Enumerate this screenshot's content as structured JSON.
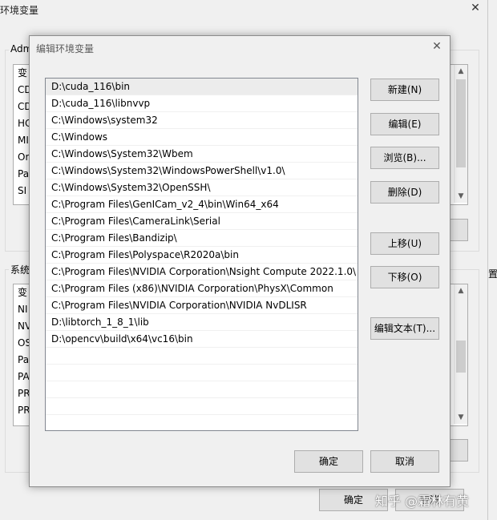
{
  "background_window": {
    "title": "环境变量",
    "close_glyph": "✕",
    "user_group_label": "Adm",
    "user_vars": [
      "变",
      "CD",
      "CD",
      "HC",
      "MI",
      "Or",
      "Pa",
      "SI"
    ],
    "system_group_label": "系统",
    "system_vars": [
      "变",
      "NI",
      "NV",
      "OS",
      "Pa",
      "PA",
      "PR",
      "PR"
    ],
    "side_text": "置",
    "ok_label": "确定",
    "cancel_label": "取消",
    "scroll_up": "▲",
    "scroll_down": "▼"
  },
  "watermark": "知乎 @霜林有黄",
  "dialog": {
    "title": "编辑环境变量",
    "close_glyph": "✕",
    "paths": [
      "D:\\cuda_116\\bin",
      "D:\\cuda_116\\libnvvp",
      "C:\\Windows\\system32",
      "C:\\Windows",
      "C:\\Windows\\System32\\Wbem",
      "C:\\Windows\\System32\\WindowsPowerShell\\v1.0\\",
      "C:\\Windows\\System32\\OpenSSH\\",
      "C:\\Program Files\\GenICam_v2_4\\bin\\Win64_x64",
      "C:\\Program Files\\CameraLink\\Serial",
      "C:\\Program Files\\Bandizip\\",
      "C:\\Program Files\\Polyspace\\R2020a\\bin",
      "C:\\Program Files\\NVIDIA Corporation\\Nsight Compute 2022.1.0\\",
      "C:\\Program Files (x86)\\NVIDIA Corporation\\PhysX\\Common",
      "C:\\Program Files\\NVIDIA Corporation\\NVIDIA NvDLISR",
      "D:\\libtorch_1_8_1\\lib",
      "D:\\opencv\\build\\x64\\vc16\\bin"
    ],
    "buttons": {
      "new": "新建(N)",
      "edit": "编辑(E)",
      "browse": "浏览(B)...",
      "delete": "删除(D)",
      "move_up": "上移(U)",
      "move_down": "下移(O)",
      "edit_text": "编辑文本(T)...",
      "ok": "确定",
      "cancel": "取消"
    }
  }
}
